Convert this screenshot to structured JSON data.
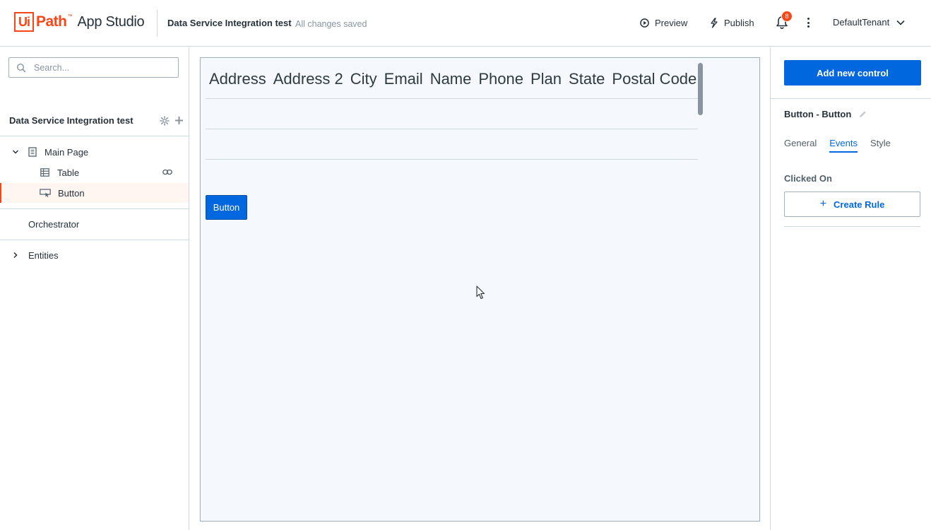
{
  "header": {
    "logo_ui": "Ui",
    "logo_path": "Path",
    "logo_tm": "™",
    "app_name": "App Studio",
    "project_title": "Data Service Integration test",
    "save_status": "All changes saved",
    "preview_label": "Preview",
    "publish_label": "Publish",
    "notification_count": "8",
    "tenant": "DefaultTenant"
  },
  "sidebar": {
    "search_placeholder": "Search...",
    "project_name": "Data Service Integration test",
    "tree": {
      "main_page": "Main Page",
      "table": "Table",
      "button": "Button"
    },
    "orchestrator": "Orchestrator",
    "entities": "Entities"
  },
  "canvas": {
    "columns": [
      "Address",
      "Address 2",
      "City",
      "Email",
      "Name",
      "Phone",
      "Plan",
      "State",
      "Postal Code"
    ],
    "button_label": "Button"
  },
  "properties": {
    "add_control_label": "Add new control",
    "control_name": "Button - Button",
    "tabs": [
      "General",
      "Events",
      "Style"
    ],
    "active_tab": "Events",
    "event_label": "Clicked On",
    "create_rule_label": "Create Rule"
  },
  "colors": {
    "brand": "#fa4616",
    "primary": "#0067df",
    "canvas_bg": "#f5f9fd"
  }
}
